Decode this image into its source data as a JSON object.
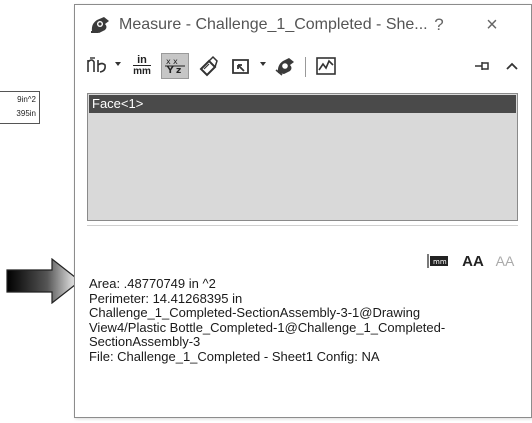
{
  "background_callout": {
    "line1": "9in^2",
    "line2": "395in"
  },
  "window": {
    "title": "Measure - Challenge_1_Completed - She...",
    "help_label": "?",
    "close_label": "×"
  },
  "toolbar": {
    "units_top": "in",
    "units_bottom": "mm",
    "icons": [
      "arc-circle-measurement-icon",
      "units-precision-icon",
      "show-xyz-measurements-icon",
      "point-to-point-icon",
      "projection-icon",
      "measurement-history-icon",
      "sensor-icon",
      "pin-icon",
      "collapse-icon"
    ]
  },
  "selection": {
    "items": [
      "Face<1>"
    ]
  },
  "results": {
    "area": "Area: .48770749 in ^2",
    "perimeter": "Perimeter: 14.41268395 in",
    "ref_line1": "Challenge_1_Completed-SectionAssembly-3-1@Drawing",
    "ref_line2": "View4/Plastic Bottle_Completed-1@Challenge_1_Completed-",
    "ref_line3": "SectionAssembly-3",
    "file": "File: Challenge_1_Completed - Sheet1 Config: NA",
    "scale_icon_label": "mm",
    "grow_font_label": "AA",
    "shrink_font_label": "AA"
  },
  "colors": {
    "selected_row": "#4a4a4a",
    "list_background": "#d9d9d9",
    "active_button": "#c6c6c6"
  }
}
